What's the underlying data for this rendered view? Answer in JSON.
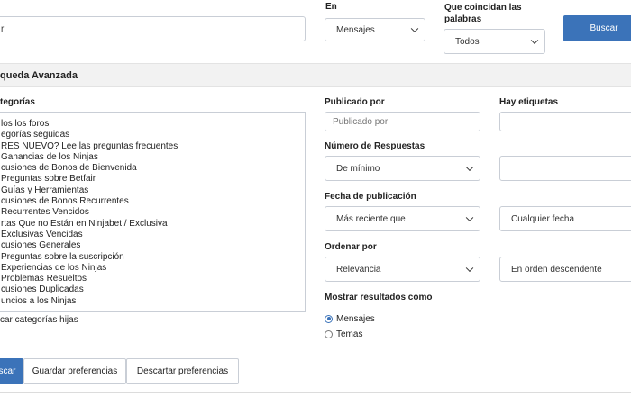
{
  "search": {
    "value": "r",
    "button_label": "Buscar"
  },
  "in_filter": {
    "label": "En",
    "selected": "Mensajes"
  },
  "match_filter": {
    "label_line1": "Que coincidan las",
    "label_line2": "palabras",
    "selected": "Todos"
  },
  "advanced": {
    "title": "queda Avanzada"
  },
  "categories": {
    "label": "tegorías",
    "items": [
      "los los foros",
      "egorías seguidas",
      "RES NUEVO? Lee las preguntas frecuentes",
      "Ganancias de los Ninjas",
      "cusiones de Bonos de Bienvenida",
      "Preguntas sobre Betfair",
      "Guías y Herramientas",
      "cusiones de Bonos Recurrentes",
      "Recurrentes Vencidos",
      "rtas Que no Están en Ninjabet / Exclusiva",
      "Exclusivas Vencidas",
      "cusiones Generales",
      "Preguntas sobre la suscripción",
      "Experiencias de los Ninjas",
      "Problemas Resueltos",
      "cusiones Duplicadas",
      "uncios a los Ninjas"
    ],
    "child_label": "car categorías hijas"
  },
  "published_by": {
    "label": "Publicado por",
    "placeholder": "Publicado por"
  },
  "tags": {
    "label": "Hay etiquetas"
  },
  "replies": {
    "label": "Número de Respuestas",
    "selected": "De mínimo"
  },
  "date": {
    "label": "Fecha de publicación",
    "selected": "Más reciente que",
    "range": "Cualquier fecha"
  },
  "order": {
    "label": "Ordenar por",
    "selected": "Relevancia",
    "direction": "En orden descendente"
  },
  "results": {
    "label": "Mostrar resultados como",
    "options": [
      "Mensajes",
      "Temas"
    ],
    "selected": "Mensajes"
  },
  "footer": {
    "search_label": "scar",
    "save_label": "Guardar preferencias",
    "discard_label": "Descartar preferencias"
  },
  "colors": {
    "accent": "#3b73b9",
    "border": "#c9ced6",
    "bar": "#f2f2f2"
  }
}
